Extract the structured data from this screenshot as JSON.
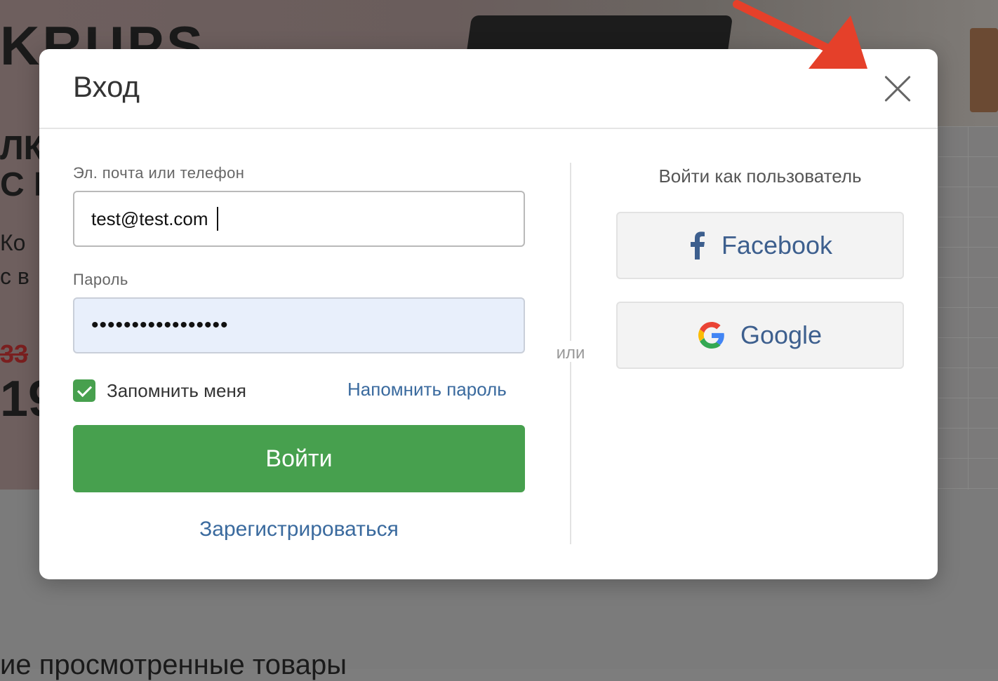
{
  "background_page": {
    "brand": "KRUPS",
    "hero_title_lines": [
      "ЛК",
      "С Г"
    ],
    "hero_sub_lines": [
      "Ко",
      "с в"
    ],
    "old_price": "33",
    "price": "19",
    "recent_section": "ие просмотренные товары"
  },
  "modal": {
    "title": "Вход",
    "email_label": "Эл. почта или телефон",
    "email_value": "test@test.com",
    "password_label": "Пароль",
    "password_value": "•••••••••••••••••",
    "remember_label": "Запомнить меня",
    "remember_checked": true,
    "forgot_link": "Напомнить пароль",
    "login_button": "Войти",
    "register_link": "Зарегистрироваться",
    "or_text": "или",
    "social_title": "Войти как пользователь",
    "social_buttons": [
      {
        "label": "Facebook",
        "icon": "facebook-icon"
      },
      {
        "label": "Google",
        "icon": "google-icon"
      }
    ]
  },
  "colors": {
    "accent_green": "#47a04e",
    "link_blue": "#3a6a9e",
    "annotation_red": "#e5402a"
  }
}
